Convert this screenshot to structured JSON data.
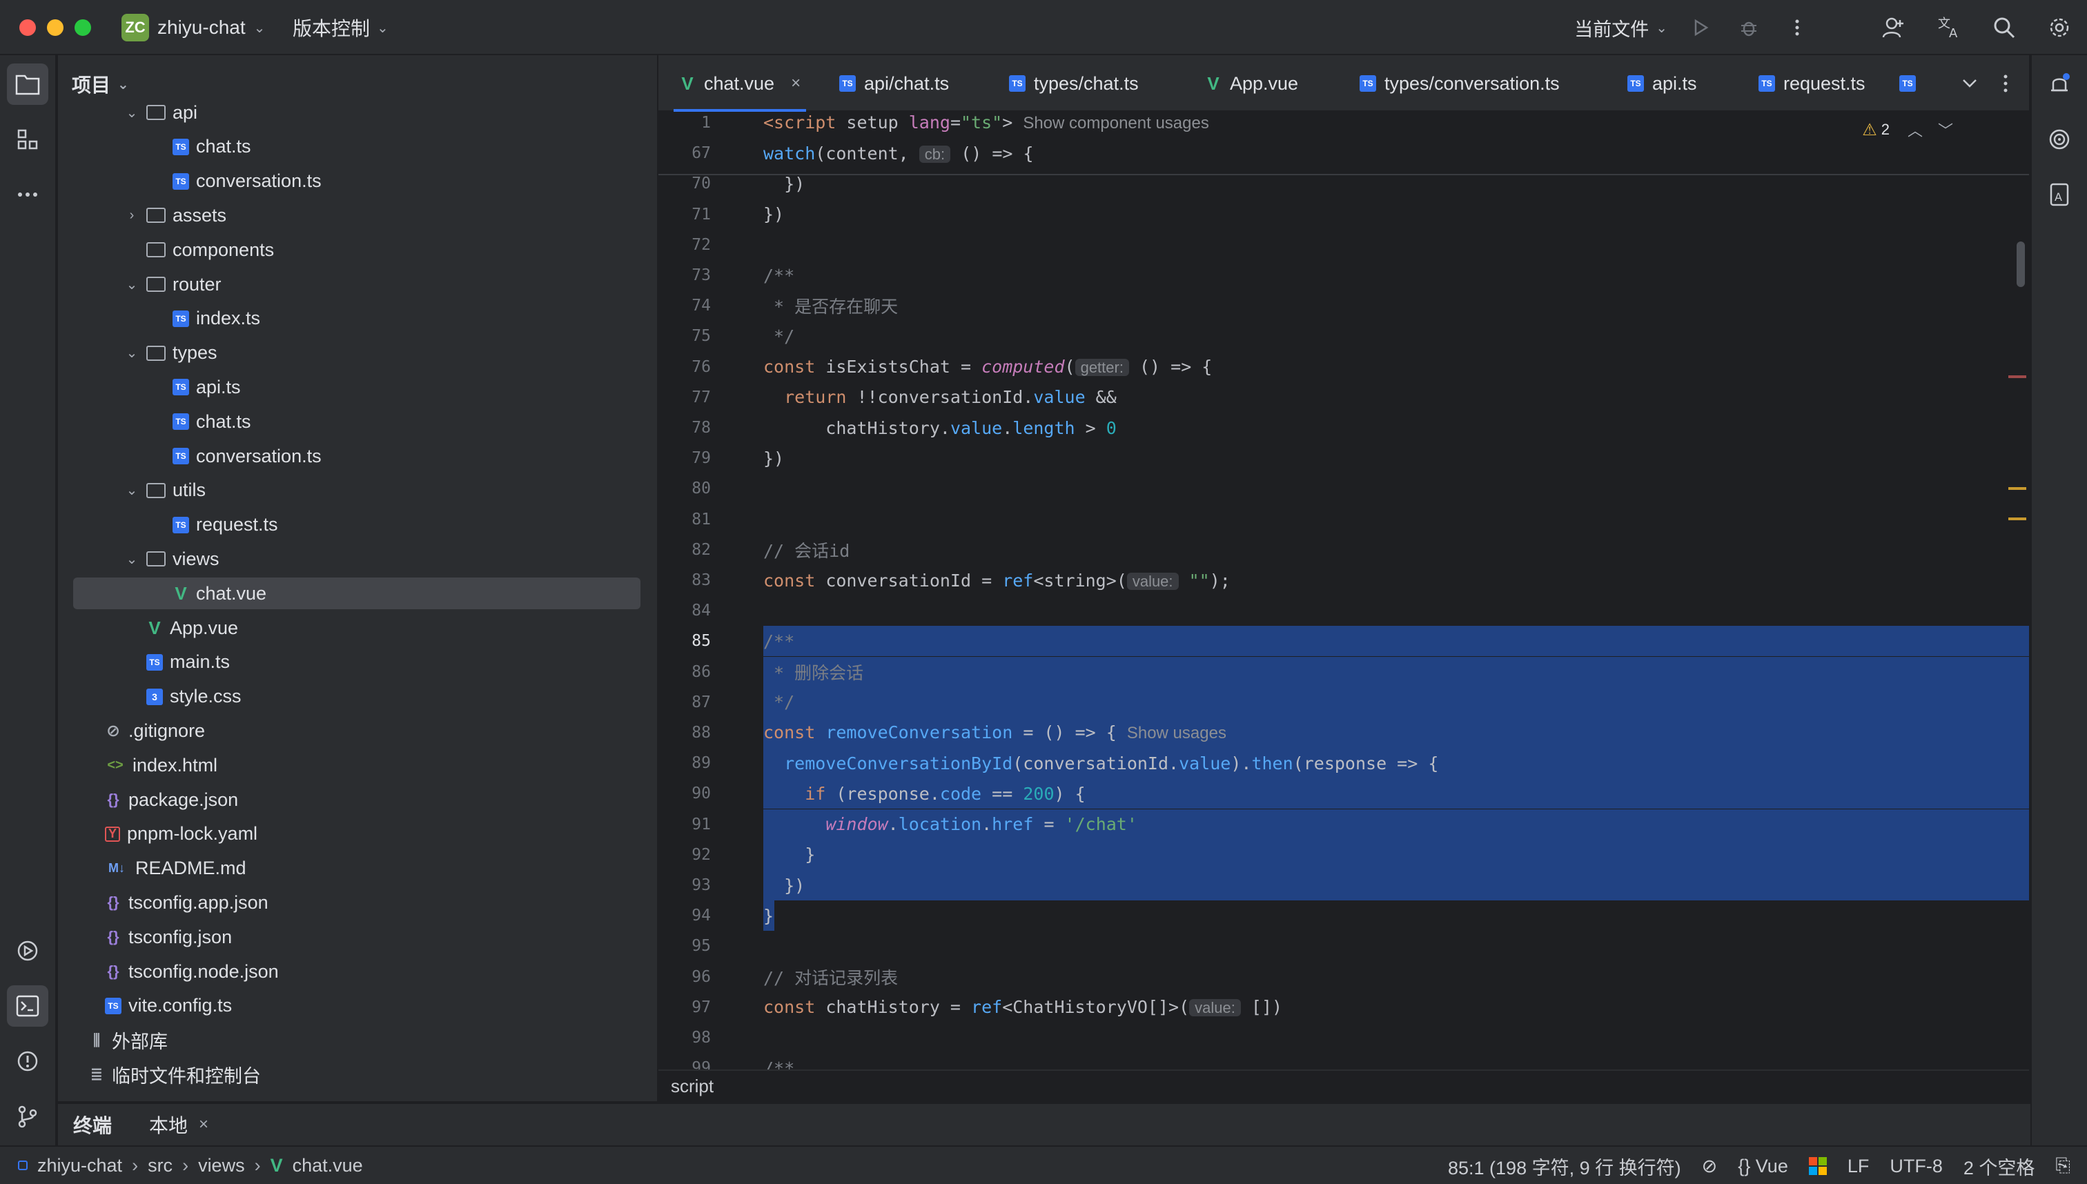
{
  "titlebar": {
    "project_badge": "ZC",
    "project_name": "zhiyu-chat",
    "vcs_label": "版本控制",
    "current_file": "当前文件"
  },
  "project_panel": {
    "header": "项目",
    "tree": [
      {
        "label": "api",
        "type": "folder",
        "indent": 2,
        "expanded": true
      },
      {
        "label": "chat.ts",
        "type": "ts",
        "indent": 3
      },
      {
        "label": "conversation.ts",
        "type": "ts",
        "indent": 3
      },
      {
        "label": "assets",
        "type": "folder",
        "indent": 2,
        "expanded": false
      },
      {
        "label": "components",
        "type": "folder",
        "indent": 2,
        "leaf": true
      },
      {
        "label": "router",
        "type": "folder",
        "indent": 2,
        "expanded": true
      },
      {
        "label": "index.ts",
        "type": "ts",
        "indent": 3
      },
      {
        "label": "types",
        "type": "folder",
        "indent": 2,
        "expanded": true
      },
      {
        "label": "api.ts",
        "type": "ts",
        "indent": 3
      },
      {
        "label": "chat.ts",
        "type": "ts",
        "indent": 3
      },
      {
        "label": "conversation.ts",
        "type": "ts",
        "indent": 3
      },
      {
        "label": "utils",
        "type": "folder",
        "indent": 2,
        "expanded": true
      },
      {
        "label": "request.ts",
        "type": "ts",
        "indent": 3
      },
      {
        "label": "views",
        "type": "folder",
        "indent": 2,
        "expanded": true
      },
      {
        "label": "chat.vue",
        "type": "vue",
        "indent": 3,
        "selected": true
      },
      {
        "label": "App.vue",
        "type": "vue",
        "indent": 2
      },
      {
        "label": "main.ts",
        "type": "ts",
        "indent": 2
      },
      {
        "label": "style.css",
        "type": "css",
        "indent": 2
      },
      {
        "label": ".gitignore",
        "type": "ignore",
        "indent": 1
      },
      {
        "label": "index.html",
        "type": "html",
        "indent": 1
      },
      {
        "label": "package.json",
        "type": "json",
        "indent": 1
      },
      {
        "label": "pnpm-lock.yaml",
        "type": "yaml",
        "indent": 1
      },
      {
        "label": "README.md",
        "type": "md",
        "indent": 1
      },
      {
        "label": "tsconfig.app.json",
        "type": "json",
        "indent": 1
      },
      {
        "label": "tsconfig.json",
        "type": "json",
        "indent": 1
      },
      {
        "label": "tsconfig.node.json",
        "type": "json",
        "indent": 1
      },
      {
        "label": "vite.config.ts",
        "type": "ts",
        "indent": 1
      },
      {
        "label": "外部库",
        "type": "lib",
        "indent": 0
      },
      {
        "label": "临时文件和控制台",
        "type": "scratch",
        "indent": 0
      }
    ]
  },
  "tabs": [
    {
      "label": "chat.vue",
      "type": "vue",
      "active": true
    },
    {
      "label": "api/chat.ts",
      "type": "ts"
    },
    {
      "label": "types/chat.ts",
      "type": "ts"
    },
    {
      "label": "App.vue",
      "type": "vue"
    },
    {
      "label": "types/conversation.ts",
      "type": "ts"
    },
    {
      "label": "api.ts",
      "type": "ts"
    },
    {
      "label": "request.ts",
      "type": "ts"
    }
  ],
  "editor": {
    "warning_count": "2",
    "footer_label": "script",
    "hints": {
      "show_component_usages": "Show component usages",
      "show_usages": "Show usages",
      "cb": "cb:",
      "getter": "getter:",
      "value": "value:"
    },
    "lines": [
      {
        "n": "1",
        "code": "<script setup lang=\"ts\">"
      },
      {
        "n": "67",
        "code": "watch(content,"
      },
      {
        "n": "70",
        "code": "  })"
      },
      {
        "n": "71",
        "code": "})"
      },
      {
        "n": "72",
        "code": ""
      },
      {
        "n": "73",
        "code": "/**"
      },
      {
        "n": "74",
        "code": " * 是否存在聊天"
      },
      {
        "n": "75",
        "code": " */"
      },
      {
        "n": "76",
        "code": "const isExistsChat = computed("
      },
      {
        "n": "77",
        "code": "  return !!conversationId.value &&"
      },
      {
        "n": "78",
        "code": "      chatHistory.value.length > 0"
      },
      {
        "n": "79",
        "code": "})"
      },
      {
        "n": "80",
        "code": ""
      },
      {
        "n": "81",
        "code": ""
      },
      {
        "n": "82",
        "code": "// 会话id"
      },
      {
        "n": "83",
        "code": "const conversationId = ref<string>("
      },
      {
        "n": "84",
        "code": ""
      },
      {
        "n": "85",
        "code": "/**"
      },
      {
        "n": "86",
        "code": " * 删除会话"
      },
      {
        "n": "87",
        "code": " */"
      },
      {
        "n": "88",
        "code": "const removeConversation = () => {"
      },
      {
        "n": "89",
        "code": "  removeConversationById(conversationId.value).then(response => {"
      },
      {
        "n": "90",
        "code": "    if (response.code == 200) {"
      },
      {
        "n": "91",
        "code": "      window.location.href = '/chat'"
      },
      {
        "n": "92",
        "code": "    }"
      },
      {
        "n": "93",
        "code": "  })"
      },
      {
        "n": "94",
        "code": "}"
      },
      {
        "n": "95",
        "code": ""
      },
      {
        "n": "96",
        "code": "// 对话记录列表"
      },
      {
        "n": "97",
        "code": "const chatHistory = ref<ChatHistoryVO[]>("
      },
      {
        "n": "98",
        "code": ""
      },
      {
        "n": "99",
        "code": "/**"
      }
    ]
  },
  "bottom_tabs": {
    "terminal": "终端",
    "local": "本地"
  },
  "statusbar": {
    "crumbs": [
      "zhiyu-chat",
      "src",
      "views",
      "chat.vue"
    ],
    "position": "85:1 (198 字符, 9 行 换行符)",
    "language": "Vue",
    "line_sep": "LF",
    "encoding": "UTF-8",
    "indent": "2 个空格"
  },
  "colors": {
    "accent": "#3574f0",
    "selection": "#214283",
    "vue_green": "#42b883"
  }
}
